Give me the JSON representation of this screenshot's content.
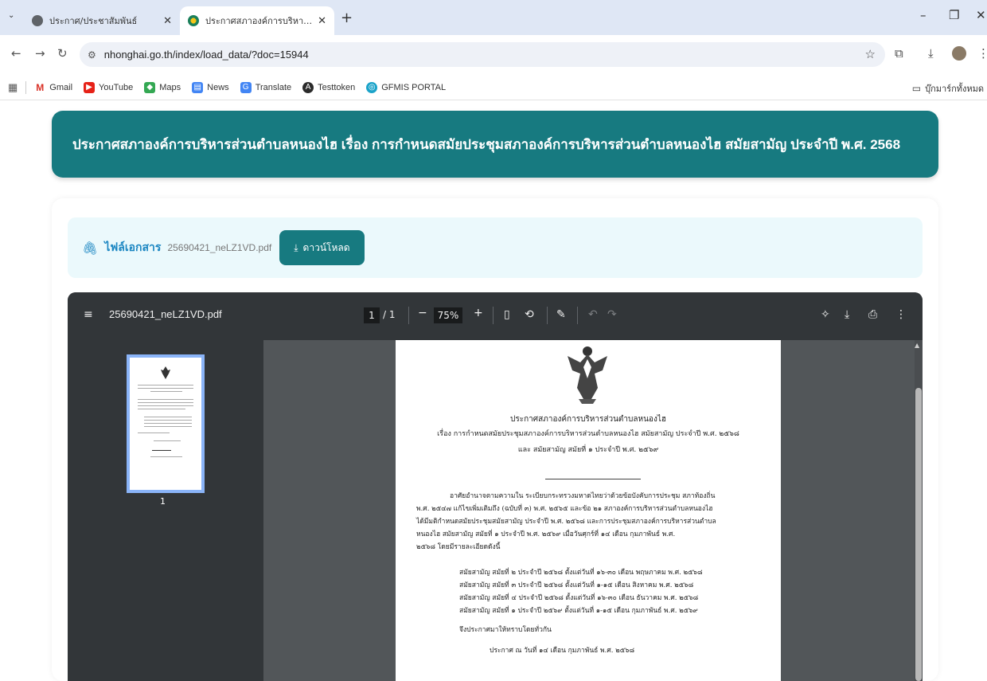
{
  "browser": {
    "tabs": [
      {
        "title": "ประกาศ/ประชาสัมพันธ์",
        "active": false
      },
      {
        "title": "ประกาศสภาองค์การบริหารส่วนตำบลหนองไฮ",
        "active": true
      }
    ],
    "new_tab_label": "+",
    "url": "nhonghai.go.th/index/load_data/?doc=15944",
    "bookmarks": [
      {
        "label": "Gmail",
        "icon": "gmail-icon"
      },
      {
        "label": "YouTube",
        "icon": "youtube-icon"
      },
      {
        "label": "Maps",
        "icon": "maps-icon"
      },
      {
        "label": "News",
        "icon": "news-icon"
      },
      {
        "label": "Translate",
        "icon": "translate-icon"
      },
      {
        "label": "Testtoken",
        "icon": "angular-icon"
      },
      {
        "label": "GFMIS PORTAL",
        "icon": "gfmis-icon"
      }
    ],
    "bookmark_folder": "บุ๊กมาร์กทั้งหมด"
  },
  "page": {
    "heading": "ประกาศสภาองค์การบริหารส่วนตำบลหนองไฮ เรื่อง การกำหนดสมัยประชุมสภาองค์การบริหารส่วนตำบลหนองไฮ สมัยสามัญ ประจำปี พ.ศ. 2568",
    "file_label": "ไฟล์เอกสาร",
    "file_name": "25690421_neLZ1VD.pdf",
    "download_label": "ดาวน์โหลด"
  },
  "viewer": {
    "title": "25690421_neLZ1VD.pdf",
    "current_page": "1",
    "total_pages": "/ 1",
    "zoom": "75%",
    "thumbnail_number": "1"
  },
  "document": {
    "title": "ประกาศสภาองค์การบริหารส่วนตำบลหนองไฮ",
    "subject_1": "เรื่อง การกำหนดสมัยประชุมสภาองค์การบริหารส่วนตำบลหนองไฮ สมัยสามัญ ประจำปี พ.ศ. ๒๕๖๘",
    "subject_2": "และ สมัยสามัญ สมัยที่ ๑ ประจำปี พ.ศ. ๒๕๖๙",
    "para_lines": [
      "อาศัยอำนาจตามความใน ระเบียบกระทรวงมหาดไทยว่าด้วยข้อบังคับการประชุม สภาท้องถิ่น",
      "พ.ศ. ๒๕๔๗ แก้ไขเพิ่มเติมถึง (ฉบับที่ ๓) พ.ศ. ๒๕๖๕ และข้อ ๒๑ สภาองค์การบริหารส่วนตำบลหนองไฮ",
      "ได้มีมติกำหนดสมัยประชุมสมัยสามัญ ประจำปี พ.ศ. ๒๕๖๘ และการประชุมสภาองค์การบริหารส่วนตำบล",
      "หนองไฮ สมัยสามัญ สมัยที่ ๑ ประจำปี พ.ศ. ๒๕๖๙ เมื่อวันศุกร์ที่ ๑๔ เดือน กุมภาพันธ์ พ.ศ.",
      "๒๕๖๘ โดยมีรายละเอียดดังนี้"
    ],
    "sessions": [
      "สมัยสามัญ สมัยที่ ๒ ประจำปี ๒๕๖๘ ตั้งแต่วันที่ ๑๖-๓๐ เดือน พฤษภาคม  พ.ศ. ๒๕๖๘",
      "สมัยสามัญ สมัยที่ ๓ ประจำปี ๒๕๖๘ ตั้งแต่วันที่ ๑-๑๕ เดือน สิงหาคม  พ.ศ. ๒๕๖๘",
      "สมัยสามัญ สมัยที่ ๔ ประจำปี ๒๕๖๘ ตั้งแต่วันที่ ๑๖-๓๐ เดือน ธันวาคม  พ.ศ. ๒๕๖๘",
      "สมัยสามัญ สมัยที่ ๑ ประจำปี ๒๕๖๙ ตั้งแต่วันที่ ๑-๑๕ เดือน กุมภาพันธ์ พ.ศ. ๒๕๖๙"
    ],
    "closing": "จึงประกาศมาให้ทราบโดยทั่วกัน",
    "announce_date": "ประกาศ ณ วันที่ ๑๔ เดือน กุมภาพันธ์ พ.ศ. ๒๕๖๘"
  },
  "colors": {
    "teal": "#177a80",
    "light_cyan": "#ebf9fc",
    "link_blue": "#1b86c2",
    "chrome_bg": "#dfe7f5",
    "viewer_toolbar": "#323639"
  }
}
